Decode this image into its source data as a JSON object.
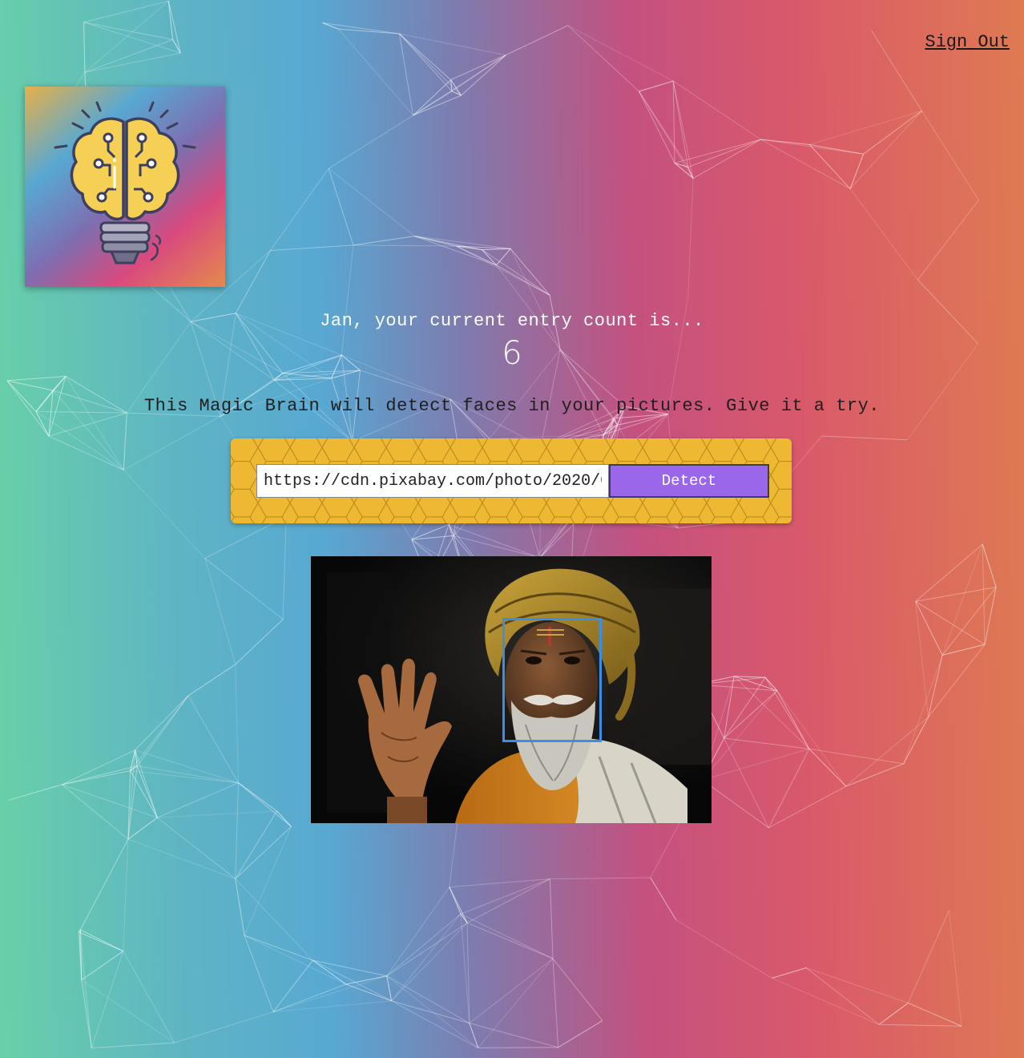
{
  "nav": {
    "sign_out_label": "Sign Out"
  },
  "logo": {
    "icon": "brain-lightbulb-icon"
  },
  "rank": {
    "greeting": "Jan, your current entry count is...",
    "count": "6"
  },
  "tagline": "This Magic Brain will detect faces in your pictures. Give it a try.",
  "form": {
    "url_value": "https://cdn.pixabay.com/photo/2020/0",
    "detect_label": "Detect"
  },
  "colors": {
    "panel_yellow": "#efb832",
    "detect_purple": "#9a67ea",
    "face_box_blue": "#3a8ee6"
  }
}
